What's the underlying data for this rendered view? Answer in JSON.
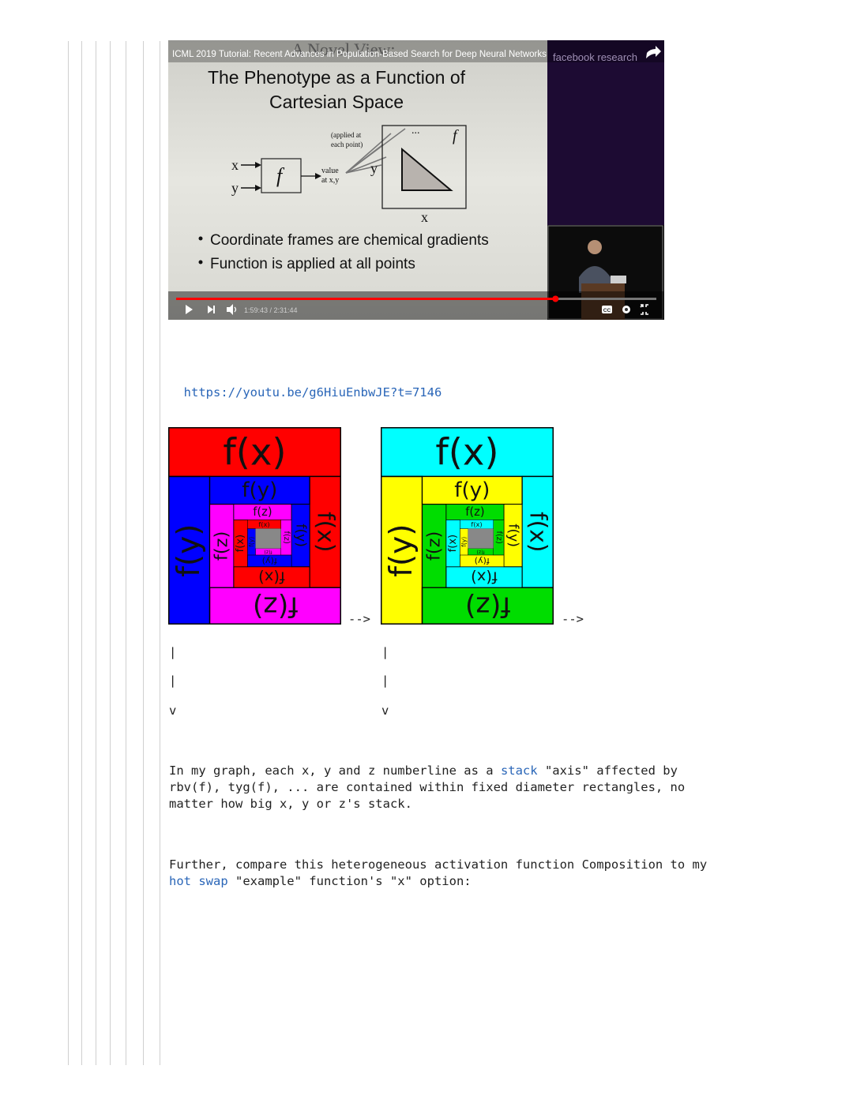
{
  "video": {
    "header": "ICML 2019 Tutorial: Recent Advances in Population-Based Search for Deep Neural Networks",
    "ghost_title": "A Novel View:",
    "brand": "facebook research",
    "slide_title_line1": "The Phenotype as a Function of",
    "slide_title_line2": "Cartesian Space",
    "label_x": "x",
    "label_y": "y",
    "label_f": "f",
    "label_value": "value",
    "label_at": "at x,y",
    "label_applied1": "(applied at",
    "label_applied2": "each point)",
    "label_dots": "...",
    "label_y_axis": "y",
    "label_x_axis": "x",
    "label_f_box": "f",
    "bullet1": "Coordinate frames are chemical gradients",
    "bullet2": "Function is applied at all points",
    "time": "1:59:43 / 2:31:44",
    "progress": 0.79,
    "cc_label": "CC"
  },
  "link_url": "https://youtu.be/g6HiuEnbwJE?t=7146",
  "fig1": {
    "colors": [
      "#ff0000",
      "#0000ff",
      "#ff00ff"
    ],
    "labels": [
      "f(x)",
      "f(y)",
      "f(z)"
    ]
  },
  "fig2": {
    "colors": [
      "#00ffff",
      "#ffff00",
      "#00dd00"
    ],
    "labels": [
      "f(x)",
      "f(y)",
      "f(z)"
    ]
  },
  "arrow_right": "-->",
  "vertical_bar": "|",
  "down_v": "v",
  "para1": {
    "text_before": "In my graph, each x, y and z numberline as a ",
    "link": "stack",
    "text_after": " \"axis\" affected by",
    "line2": "rbv(f), tyg(f), ... are contained within fixed diameter rectangles, no",
    "line3": "matter how big x, y or z's stack."
  },
  "para2": {
    "line1": "Further, compare this heterogeneous activation function Composition to my",
    "link": "hot swap",
    "text_after": " \"example\" function's \"x\" option:"
  }
}
